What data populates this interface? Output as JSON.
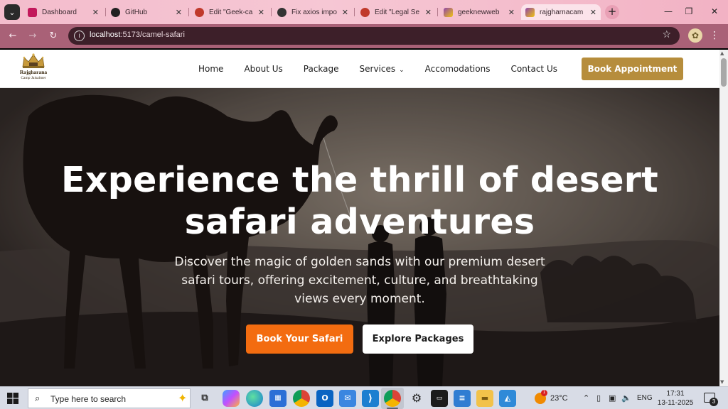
{
  "browser": {
    "tabs": [
      {
        "title": "Dashboard",
        "favicon_color": "#c2185b",
        "active": false
      },
      {
        "title": "GitHub",
        "favicon_color": "#222222",
        "active": false
      },
      {
        "title": "Edit \"Geek-ca",
        "favicon_color": "#c0392b",
        "active": false
      },
      {
        "title": "Fix axios impo",
        "favicon_color": "#333333",
        "active": false
      },
      {
        "title": "Edit \"Legal Se",
        "favicon_color": "#c0392b",
        "active": false
      },
      {
        "title": "geeknewweb",
        "favicon_color": "#8e44ad",
        "active": false
      },
      {
        "title": "rajgharnacam",
        "favicon_color": "#8e44ad",
        "active": true
      }
    ],
    "new_tab_label": "+",
    "url_host": "localhost",
    "url_path": ":5173/camel-safari"
  },
  "site": {
    "logo": {
      "line1": "Rajgharana",
      "line2": "Camp Jaisalmer"
    },
    "nav": [
      {
        "label": "Home"
      },
      {
        "label": "About Us"
      },
      {
        "label": "Package"
      },
      {
        "label": "Services",
        "has_dropdown": true
      },
      {
        "label": "Accomodations"
      },
      {
        "label": "Contact Us"
      }
    ],
    "book_button": "Book Appointment",
    "accent_color": "#b68d3c",
    "hero": {
      "title": "Experience the thrill of desert safari adventures",
      "subtitle": "Discover the magic of golden sands with our premium desert safari tours, offering excitement, culture, and breathtaking views every moment.",
      "primary_cta": "Book Your Safari",
      "secondary_cta": "Explore Packages",
      "primary_color": "#f36c10"
    }
  },
  "taskbar": {
    "search_placeholder": "Type here to search",
    "weather_temp": "23°C",
    "weather_badge": "1",
    "language": "ENG",
    "time": "17:31",
    "date": "13-11-2025",
    "notification_count": "3"
  }
}
